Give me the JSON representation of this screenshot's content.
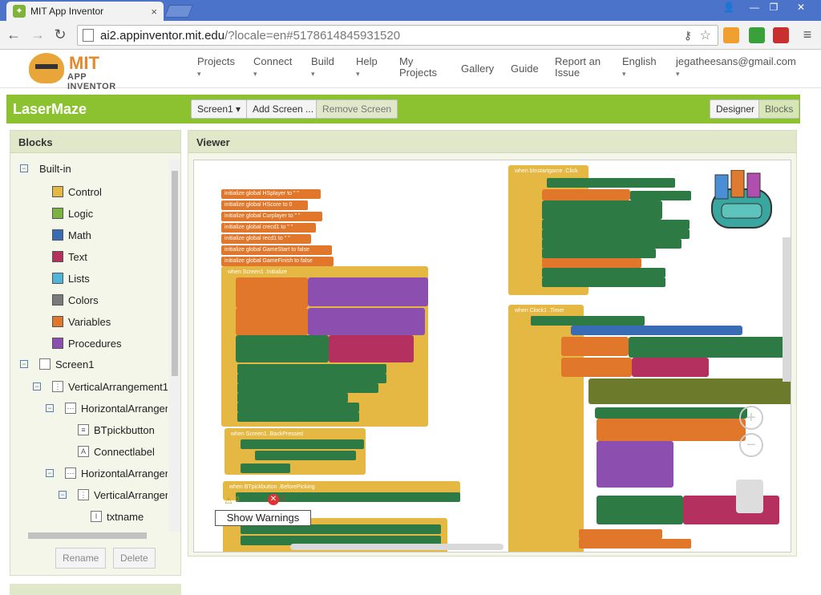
{
  "browser": {
    "tab_title": "MIT App Inventor",
    "tab_close": "×",
    "url_host": "ai2.appinventor.mit.edu",
    "url_rest": "/?locale=en#5178614845931520"
  },
  "header": {
    "logo_mit": "MIT",
    "logo_sub": "APP INVENTOR",
    "menus": [
      {
        "label": "Projects",
        "has_caret": true
      },
      {
        "label": "Connect",
        "has_caret": true
      },
      {
        "label": "Build",
        "has_caret": true
      },
      {
        "label": "Help",
        "has_caret": true
      },
      {
        "label": "My Projects",
        "has_caret": false
      },
      {
        "label": "Gallery",
        "has_caret": false
      },
      {
        "label": "Guide",
        "has_caret": false
      },
      {
        "label": "Report an Issue",
        "has_caret": false
      },
      {
        "label": "English",
        "has_caret": true
      },
      {
        "label": "jegatheesans@gmail.com",
        "has_caret": true
      }
    ]
  },
  "project": {
    "name": "LaserMaze",
    "screen_select": "Screen1 ▾",
    "add_screen": "Add Screen ...",
    "remove_screen": "Remove Screen",
    "designer": "Designer",
    "blocks": "Blocks"
  },
  "blocks_panel": {
    "title": "Blocks",
    "builtin": "Built-in",
    "categories": [
      {
        "label": "Control",
        "color": "#e5b843"
      },
      {
        "label": "Logic",
        "color": "#7db342"
      },
      {
        "label": "Math",
        "color": "#3a6cb5"
      },
      {
        "label": "Text",
        "color": "#b3305f"
      },
      {
        "label": "Lists",
        "color": "#4fb5d9"
      },
      {
        "label": "Colors",
        "color": "#7a7a7a"
      },
      {
        "label": "Variables",
        "color": "#e0772a"
      },
      {
        "label": "Procedures",
        "color": "#8c4fb0"
      }
    ],
    "components": [
      {
        "label": "Screen1",
        "icon": "screen"
      },
      {
        "label": "VerticalArrangement1",
        "icon": "vert"
      },
      {
        "label": "HorizontalArrangem",
        "icon": "horiz"
      },
      {
        "label": "BTpickbutton",
        "icon": "list"
      },
      {
        "label": "Connectlabel",
        "icon": "A"
      },
      {
        "label": "HorizontalArrangem",
        "icon": "horiz"
      },
      {
        "label": "VerticalArrangem",
        "icon": "vert"
      },
      {
        "label": "txtname",
        "icon": "I"
      }
    ],
    "rename": "Rename",
    "delete": "Delete"
  },
  "viewer": {
    "title": "Viewer",
    "show_warnings": "Show Warnings",
    "warning_count": "0",
    "error_count": "0",
    "blocks_left": [
      "initialize global HSplayer to \" \"",
      "initialize global HScore to 0",
      "initialize global Curplayer to \" \"",
      "initialize global crecd1 to \" \"",
      "initialize global recd1 to \" \"",
      "initialize global GameStart to false",
      "initialize global GameFinish to false"
    ],
    "event_init": "when Screen1 .Initialize",
    "event_back": "when Screen1 .BackPressed",
    "event_before": "when BTpickbutton .BeforePicking",
    "event_click": "when btnstartgame .Click",
    "event_timer": "when Clock1 .Timer"
  }
}
